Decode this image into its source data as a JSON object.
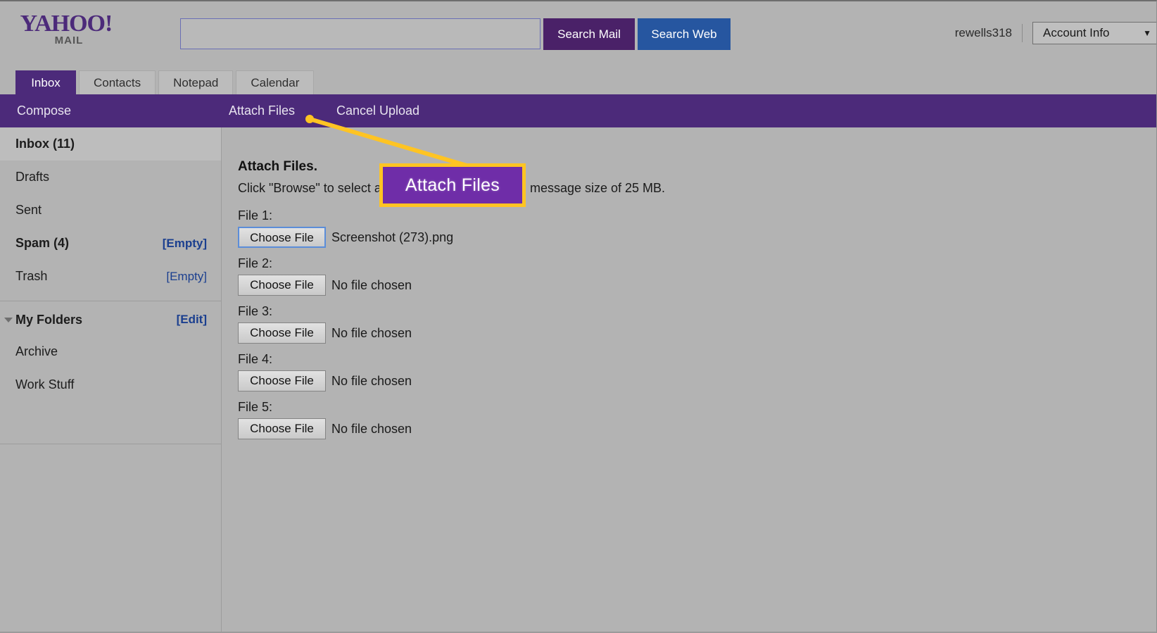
{
  "brand": {
    "logo_primary": "YAHOO!",
    "logo_secondary": "MAIL",
    "logo_color": "#4c2a7a"
  },
  "header": {
    "search_value": "",
    "search_placeholder": "",
    "search_mail_label": "Search Mail",
    "search_web_label": "Search Web",
    "search_mail_color": "#4a2168",
    "search_web_color": "#2656a0",
    "username": "rewells318",
    "account_menu_label": "Account Info",
    "account_caret": "▼"
  },
  "tabs": [
    {
      "label": "Inbox",
      "active": true
    },
    {
      "label": "Contacts",
      "active": false
    },
    {
      "label": "Notepad",
      "active": false
    },
    {
      "label": "Calendar",
      "active": false
    }
  ],
  "toolbar": {
    "background": "#4c2a7a",
    "compose_label": "Compose",
    "attach_label": "Attach Files",
    "cancel_label": "Cancel Upload"
  },
  "sidebar": {
    "items": [
      {
        "label": "Inbox (11)",
        "action": "",
        "bold": true,
        "selected": true
      },
      {
        "label": "Drafts",
        "action": "",
        "bold": false,
        "selected": false
      },
      {
        "label": "Sent",
        "action": "",
        "bold": false,
        "selected": false
      },
      {
        "label": "Spam (4)",
        "action": "[Empty]",
        "bold": true,
        "selected": false
      },
      {
        "label": "Trash",
        "action": "[Empty]",
        "bold": false,
        "selected": false
      }
    ],
    "folders_header": "My Folders",
    "folders_edit": "[Edit]",
    "folders": [
      {
        "label": "Archive"
      },
      {
        "label": "Work Stuff"
      }
    ],
    "link_color": "#1b3f8f"
  },
  "main": {
    "title": "Attach Files.",
    "description": "Click \"Browse\" to select a file to attach, up to a total message size of 25 MB.",
    "files": [
      {
        "label": "File 1:",
        "button": "Choose File",
        "status": "Screenshot (273).png",
        "focused": true
      },
      {
        "label": "File 2:",
        "button": "Choose File",
        "status": "No file chosen",
        "focused": false
      },
      {
        "label": "File 3:",
        "button": "Choose File",
        "status": "No file chosen",
        "focused": false
      },
      {
        "label": "File 4:",
        "button": "Choose File",
        "status": "No file chosen",
        "focused": false
      },
      {
        "label": "File 5:",
        "button": "Choose File",
        "status": "No file chosen",
        "focused": false
      }
    ]
  },
  "callout": {
    "label": "Attach Files",
    "border_color": "#ffc423",
    "fill_color": "#6f2da8",
    "text_color": "#ffffff",
    "arrow_color": "#ffc423"
  }
}
